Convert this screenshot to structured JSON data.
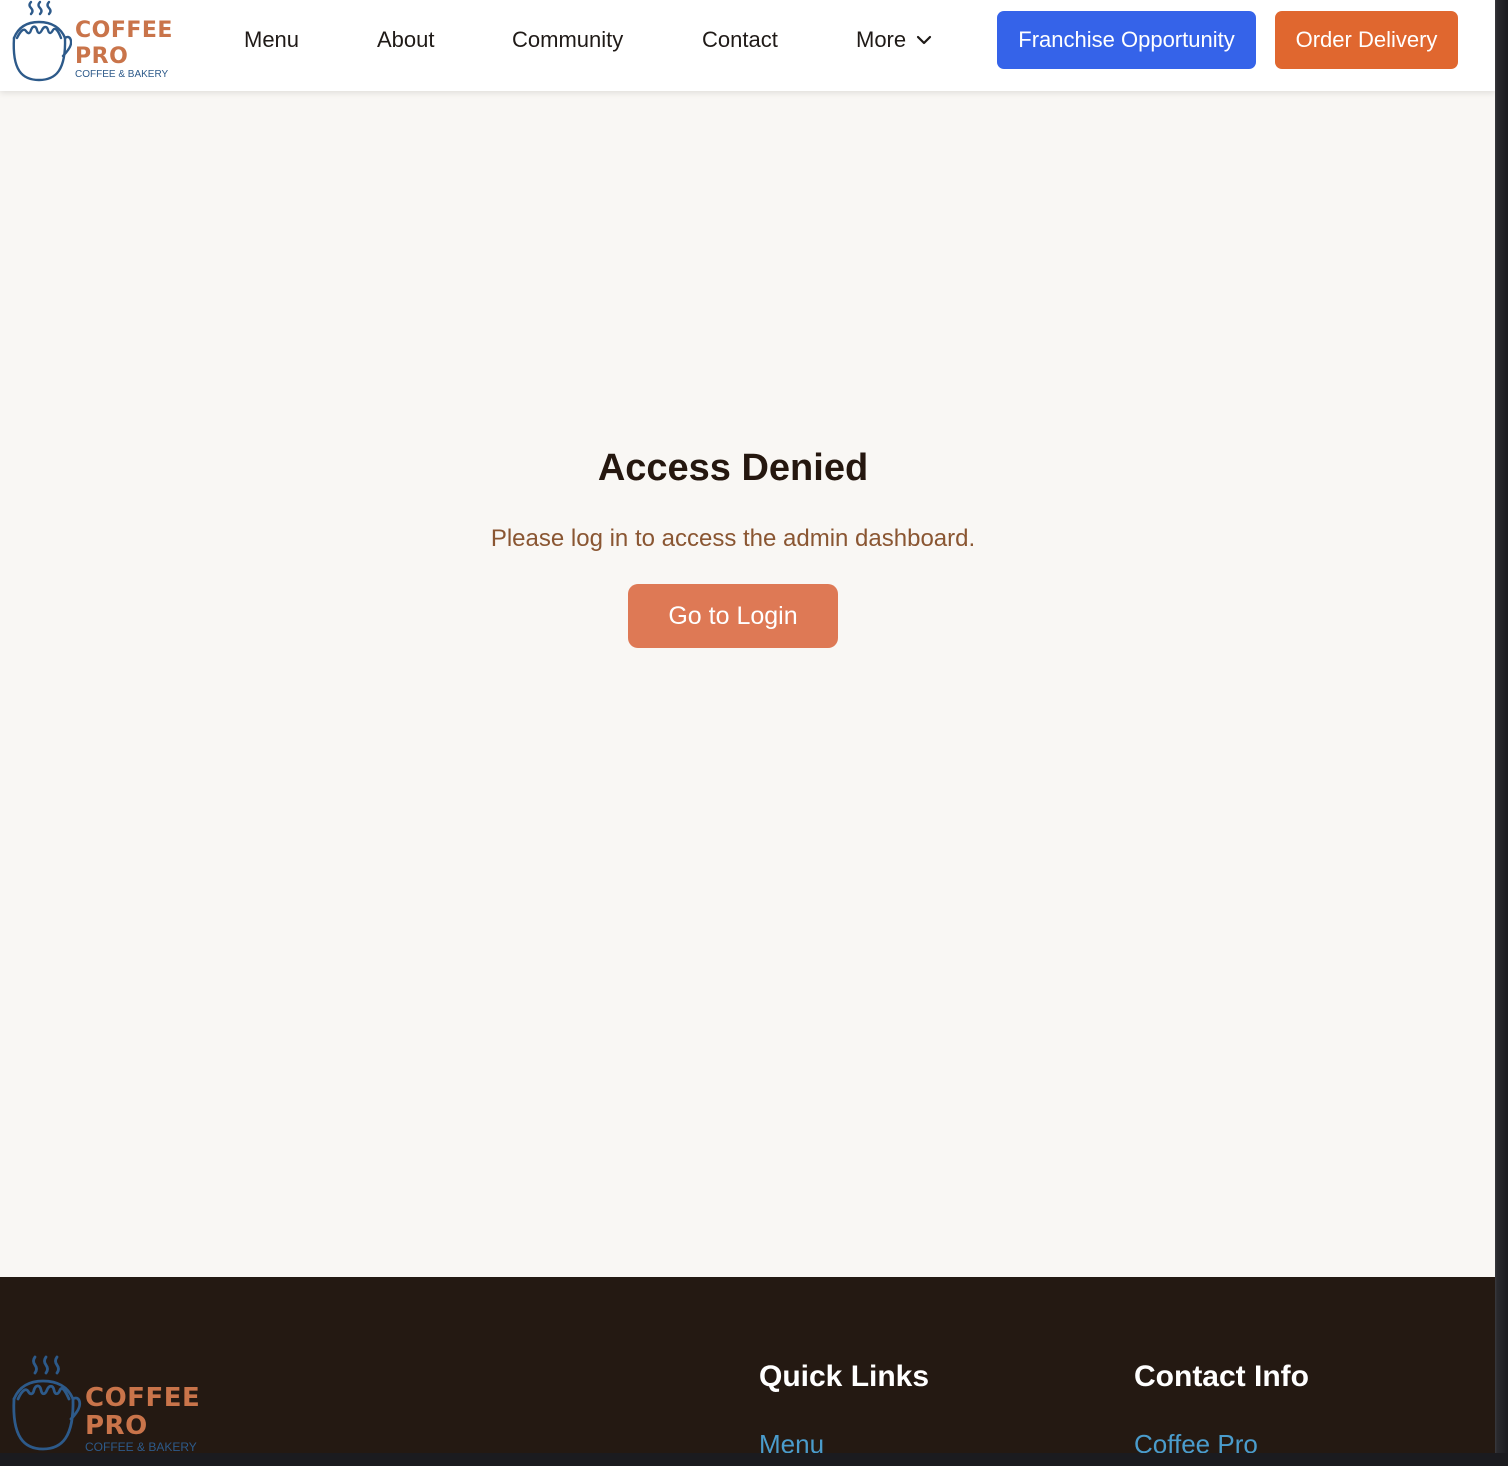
{
  "header": {
    "logo": {
      "word1": "COFFEE",
      "word2": "PRO",
      "tagline": "COFFEE & BAKERY",
      "icon": "coffee-cup-logo-icon"
    },
    "nav": {
      "menu": "Menu",
      "about": "About",
      "community": "Community",
      "contact": "Contact",
      "more": "More",
      "more_icon": "chevron-down-icon"
    },
    "buttons": {
      "franchise": "Franchise Opportunity",
      "order": "Order Delivery"
    }
  },
  "main": {
    "title": "Access Denied",
    "message": "Please log in to access the admin dashboard.",
    "login_button": "Go to Login"
  },
  "footer": {
    "logo": {
      "word1": "COFFEE",
      "word2": "PRO",
      "tagline": "COFFEE & BAKERY"
    },
    "quick_links": {
      "heading": "Quick Links",
      "items": [
        "Menu"
      ]
    },
    "contact_info": {
      "heading": "Contact Info",
      "items": [
        "Coffee Pro"
      ]
    }
  },
  "colors": {
    "page_bg": "#f9f7f4",
    "header_bg": "#ffffff",
    "footer_bg": "#241912",
    "brand_orange": "#c9744a",
    "brand_blue": "#2d5a8a",
    "franchise_button": "#3563e9",
    "order_button": "#e0672f",
    "login_button": "#de7955",
    "footer_link": "#4a9ccc"
  }
}
